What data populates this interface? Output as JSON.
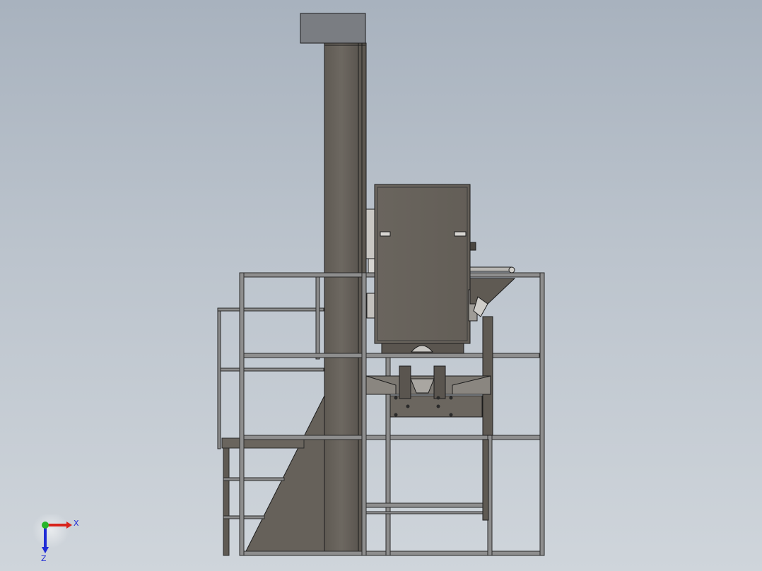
{
  "view": {
    "background_top": "#a8b2be",
    "background_bottom": "#cfd5db",
    "model_steel_color": "#6a655e",
    "model_edge_color": "#1c1c1c",
    "rail_color": "#8e8e8e"
  },
  "triad": {
    "x_label": "X",
    "z_label": "Z",
    "x_color": "#d8241c",
    "y_color": "#27b52a",
    "z_color": "#1f2bd6"
  }
}
